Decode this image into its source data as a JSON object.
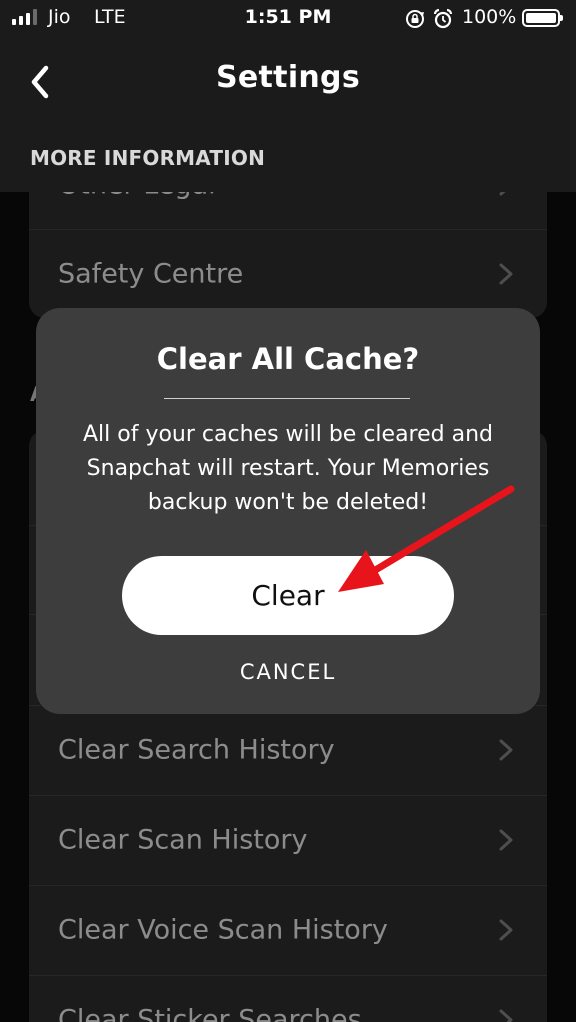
{
  "status_bar": {
    "carrier": "Jio",
    "network": "LTE",
    "time": "1:51 PM",
    "battery": "100%",
    "signal_bars_filled": 3,
    "signal_bars_total": 4
  },
  "header": {
    "title": "Settings",
    "section": "MORE INFORMATION",
    "back_icon": "chevron-left-icon"
  },
  "list": {
    "partial_item": "Other Legal",
    "safety_centre": "Safety Centre",
    "section_letter": "A",
    "clear_search_history": "Clear Search History",
    "clear_scan_history": "Clear Scan History",
    "clear_voice_scan_history": "Clear Voice Scan History",
    "clear_sticker_searches": "Clear Sticker Searches"
  },
  "dialog": {
    "title": "Clear All Cache?",
    "message": "All of your caches will be cleared and Snapchat will restart. Your Memories backup won't be deleted!",
    "confirm_label": "Clear",
    "cancel_label": "CANCEL"
  },
  "colors": {
    "background": "#0d0d0d",
    "header": "#1b1b1b",
    "card": "#323232",
    "dialog": "#3d3d3d",
    "annotation": "#e8141c"
  }
}
